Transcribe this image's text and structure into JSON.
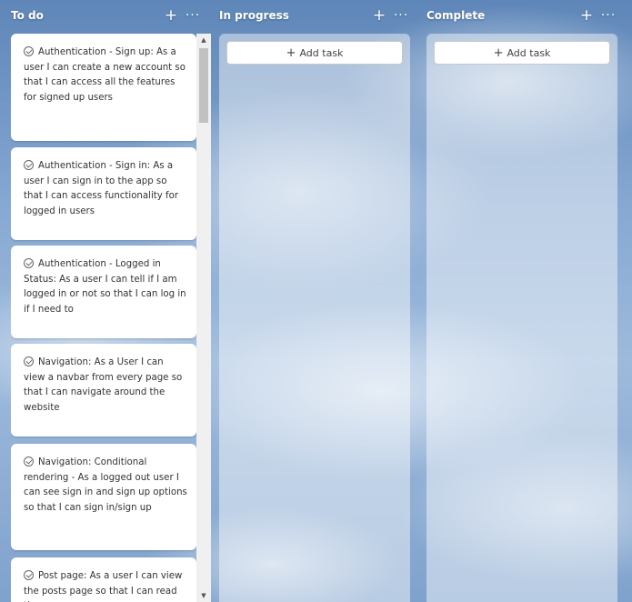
{
  "columns": [
    {
      "title": "To do",
      "add_icon": "plus-icon",
      "more_icon": "more-icon"
    },
    {
      "title": "In progress",
      "add_icon": "plus-icon",
      "more_icon": "more-icon",
      "add_task_label": "Add task"
    },
    {
      "title": "Complete",
      "add_icon": "plus-icon",
      "more_icon": "more-icon",
      "add_task_label": "Add task"
    }
  ],
  "todo_cards": [
    {
      "text": "Authentication - Sign up: As a user I can create a new account so that I can access all the features for signed up users"
    },
    {
      "text": "Authentication - Sign in: As a user I can sign in to the app so that I can access functionality for logged in users"
    },
    {
      "text": "Authentication - Logged in Status: As a user I can tell if I am logged in or not so that I can log in if I need to"
    },
    {
      "text": "Navigation: As a User I can view a navbar from every page so that I can navigate around the website"
    },
    {
      "text": "Navigation: Conditional rendering - As a logged out user I can see sign in and sign up options so that I can sign in/sign up"
    },
    {
      "text": "Post page: As a user I can view the posts page so that I can read the"
    }
  ],
  "glyphs": {
    "plus": "+",
    "more": "···",
    "up": "▲",
    "down": "▼"
  }
}
